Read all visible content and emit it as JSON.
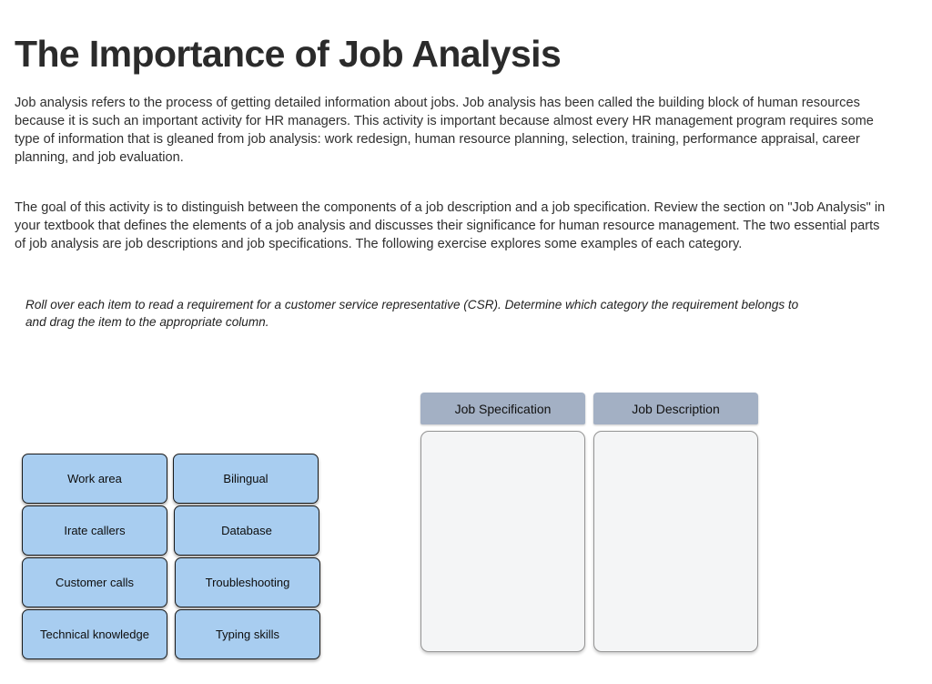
{
  "page": {
    "title": "The Importance of Job Analysis"
  },
  "body": {
    "paragraph_one": "Job analysis refers to the process of getting detailed information about jobs. Job analysis has been called the building block of human resources because it is such an important activity for HR managers. This activity is important because almost every HR management program requires some type of information that is gleaned from job analysis: work redesign, human resource planning, selection, training, performance appraisal, career planning, and job evaluation.",
    "paragraph_two": "The goal of this activity is to distinguish between the components of a job description and a job specification. Review the section on \"Job Analysis\" in your textbook that defines the elements of a job analysis and discusses their significance for human resource management. The two essential parts of job analysis are job descriptions and job specifications. The following exercise explores some examples of each category.",
    "instruction": "Roll over each item to read a requirement for a customer service representative (CSR). Determine which category the requirement belongs to and drag the item to the appropriate column."
  },
  "tiles": [
    {
      "label": "Work area"
    },
    {
      "label": "Bilingual"
    },
    {
      "label": "Irate callers"
    },
    {
      "label": "Database"
    },
    {
      "label": "Customer calls"
    },
    {
      "label": "Troubleshooting"
    },
    {
      "label": "Technical knowledge"
    },
    {
      "label": "Typing skills"
    }
  ],
  "drop_columns": [
    {
      "header": "Job Specification",
      "items": []
    },
    {
      "header": "Job Description",
      "items": []
    }
  ],
  "colors": {
    "tile_fill": "#a8cdf0",
    "tile_border": "#1a1a1a",
    "column_header_fill": "#a3b0c4",
    "dropzone_fill": "#f4f5f6",
    "dropzone_border": "#949494",
    "title_text": "#2b2b2b",
    "body_text": "#2f2f2f",
    "page_background": "#ffffff"
  }
}
